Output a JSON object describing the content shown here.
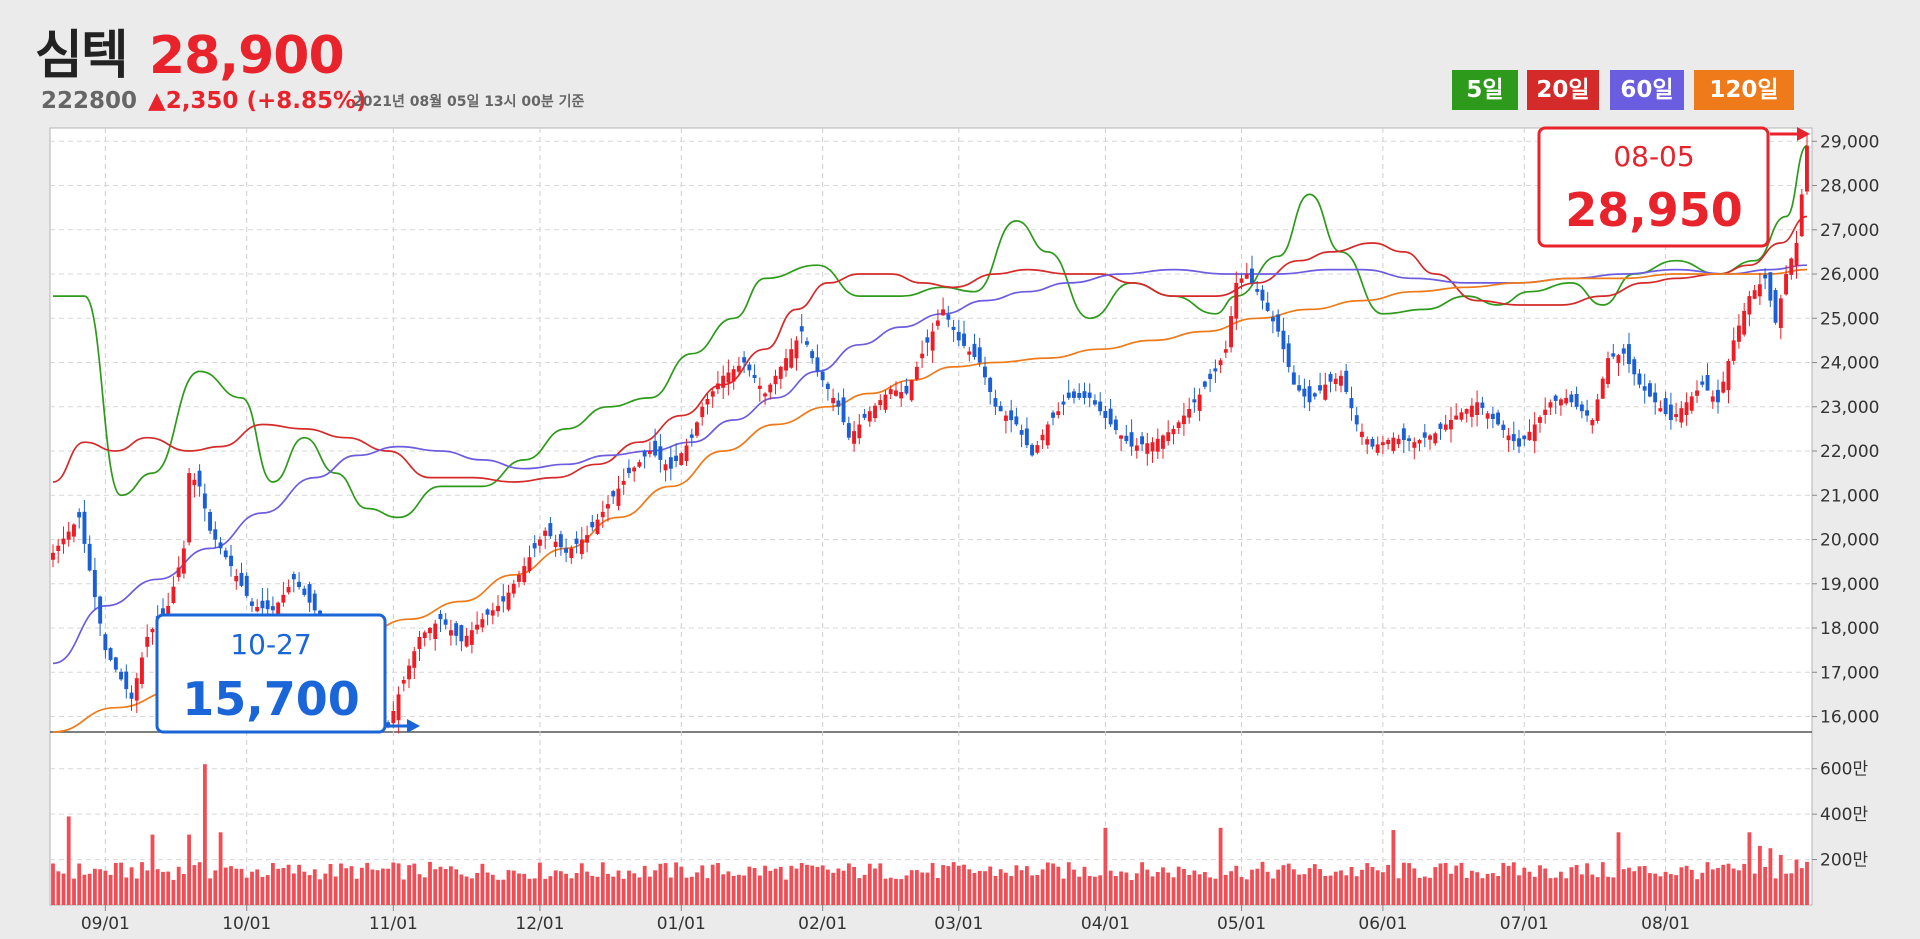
{
  "header": {
    "name": "심텍",
    "price": "28,900",
    "code": "222800",
    "change": "▲2,350 (+8.85%)",
    "timestamp": "2021년 08월 05일 13시 00분 기준"
  },
  "legend": [
    {
      "label": "5일",
      "color": "#2e9a1b"
    },
    {
      "label": "20일",
      "color": "#d42a2a"
    },
    {
      "label": "60일",
      "color": "#6b5de0"
    },
    {
      "label": "120일",
      "color": "#ee7a1a"
    }
  ],
  "callouts": {
    "high": {
      "date": "08-05",
      "value": "28,950"
    },
    "low": {
      "date": "10-27",
      "value": "15,700"
    }
  },
  "chart_data": {
    "type": "candlestick",
    "x_label_dates": [
      "09/01",
      "10/01",
      "11/01",
      "12/01",
      "01/01",
      "02/01",
      "03/01",
      "04/01",
      "05/01",
      "06/01",
      "07/01",
      "08/01"
    ],
    "price_axis": {
      "ylim": [
        15650,
        29300
      ],
      "ticks": [
        "16,000",
        "17,000",
        "18,000",
        "19,000",
        "20,000",
        "21,000",
        "22,000",
        "23,000",
        "24,000",
        "25,000",
        "26,000",
        "27,000",
        "28,000",
        "29,000"
      ]
    },
    "volume_axis": {
      "unit": "만",
      "ticks": [
        "200만",
        "400만",
        "600만"
      ],
      "max": 700
    },
    "close_anchors": [
      [
        0,
        19700
      ],
      [
        5,
        20500
      ],
      [
        10,
        17500
      ],
      [
        15,
        16400
      ],
      [
        18,
        17800
      ],
      [
        22,
        18500
      ],
      [
        25,
        19800
      ],
      [
        26,
        21500
      ],
      [
        28,
        21200
      ],
      [
        30,
        20200
      ],
      [
        34,
        19400
      ],
      [
        38,
        18500
      ],
      [
        42,
        18400
      ],
      [
        46,
        19100
      ],
      [
        50,
        18400
      ],
      [
        54,
        17500
      ],
      [
        58,
        17000
      ],
      [
        62,
        16200
      ],
      [
        64,
        15750
      ],
      [
        66,
        16500
      ],
      [
        70,
        17800
      ],
      [
        74,
        18200
      ],
      [
        78,
        17700
      ],
      [
        82,
        18200
      ],
      [
        86,
        18600
      ],
      [
        90,
        19400
      ],
      [
        94,
        20200
      ],
      [
        98,
        19700
      ],
      [
        102,
        20100
      ],
      [
        106,
        20800
      ],
      [
        110,
        21500
      ],
      [
        114,
        22000
      ],
      [
        118,
        21600
      ],
      [
        122,
        22300
      ],
      [
        124,
        23000
      ],
      [
        128,
        23700
      ],
      [
        132,
        24000
      ],
      [
        136,
        23300
      ],
      [
        140,
        24100
      ],
      [
        143,
        24700
      ],
      [
        146,
        23800
      ],
      [
        150,
        23000
      ],
      [
        152,
        22300
      ],
      [
        156,
        22900
      ],
      [
        160,
        23400
      ],
      [
        163,
        23300
      ],
      [
        166,
        24200
      ],
      [
        170,
        25200
      ],
      [
        173,
        24500
      ],
      [
        177,
        24000
      ],
      [
        180,
        23000
      ],
      [
        184,
        22600
      ],
      [
        187,
        21900
      ],
      [
        190,
        22600
      ],
      [
        194,
        23200
      ],
      [
        198,
        23200
      ],
      [
        202,
        22600
      ],
      [
        206,
        22100
      ],
      [
        210,
        22200
      ],
      [
        214,
        22500
      ],
      [
        218,
        23100
      ],
      [
        222,
        23800
      ],
      [
        224,
        24300
      ],
      [
        226,
        25800
      ],
      [
        228,
        26000
      ],
      [
        231,
        25400
      ],
      [
        234,
        24700
      ],
      [
        237,
        23500
      ],
      [
        240,
        23100
      ],
      [
        243,
        23500
      ],
      [
        246,
        23700
      ],
      [
        249,
        22600
      ],
      [
        252,
        22100
      ],
      [
        256,
        22300
      ],
      [
        260,
        22200
      ],
      [
        264,
        22400
      ],
      [
        268,
        22800
      ],
      [
        272,
        23100
      ],
      [
        276,
        22600
      ],
      [
        280,
        22100
      ],
      [
        283,
        22600
      ],
      [
        286,
        23100
      ],
      [
        289,
        23200
      ],
      [
        292,
        22900
      ],
      [
        294,
        22700
      ],
      [
        297,
        24100
      ],
      [
        300,
        24200
      ],
      [
        303,
        23500
      ],
      [
        306,
        23100
      ],
      [
        309,
        22700
      ],
      [
        312,
        23100
      ],
      [
        315,
        23500
      ],
      [
        318,
        23100
      ],
      [
        321,
        24500
      ],
      [
        324,
        25500
      ],
      [
        327,
        25900
      ],
      [
        329,
        24900
      ],
      [
        331,
        26000
      ],
      [
        333,
        26700
      ],
      [
        335,
        28900
      ]
    ],
    "ma": [
      {
        "name": "5일",
        "color": "#2e9a1b",
        "points": [
          [
            0,
            25500
          ],
          [
            6,
            25500
          ],
          [
            13,
            21000
          ],
          [
            19,
            21500
          ],
          [
            28,
            23800
          ],
          [
            36,
            23200
          ],
          [
            42,
            21300
          ],
          [
            48,
            22300
          ],
          [
            54,
            21500
          ],
          [
            60,
            20700
          ],
          [
            66,
            20500
          ],
          [
            74,
            21200
          ],
          [
            82,
            21200
          ],
          [
            90,
            21800
          ],
          [
            98,
            22500
          ],
          [
            106,
            23000
          ],
          [
            114,
            23200
          ],
          [
            122,
            24200
          ],
          [
            130,
            25000
          ],
          [
            136,
            25900
          ],
          [
            146,
            26200
          ],
          [
            154,
            25500
          ],
          [
            162,
            25500
          ],
          [
            170,
            25700
          ],
          [
            176,
            25600
          ],
          [
            184,
            27200
          ],
          [
            190,
            26500
          ],
          [
            198,
            25000
          ],
          [
            206,
            25800
          ],
          [
            214,
            25500
          ],
          [
            222,
            25100
          ],
          [
            226,
            25500
          ],
          [
            234,
            26400
          ],
          [
            240,
            27800
          ],
          [
            246,
            26500
          ],
          [
            254,
            25100
          ],
          [
            262,
            25200
          ],
          [
            270,
            25500
          ],
          [
            276,
            25300
          ],
          [
            282,
            25600
          ],
          [
            290,
            25800
          ],
          [
            296,
            25300
          ],
          [
            302,
            26000
          ],
          [
            310,
            26300
          ],
          [
            318,
            26000
          ],
          [
            325,
            26300
          ],
          [
            331,
            27300
          ],
          [
            335,
            28900
          ]
        ]
      },
      {
        "name": "20일",
        "color": "#d42a2a",
        "points": [
          [
            0,
            21300
          ],
          [
            6,
            22200
          ],
          [
            12,
            22000
          ],
          [
            18,
            22300
          ],
          [
            26,
            22000
          ],
          [
            32,
            22100
          ],
          [
            40,
            22600
          ],
          [
            48,
            22500
          ],
          [
            56,
            22300
          ],
          [
            64,
            22000
          ],
          [
            72,
            21400
          ],
          [
            80,
            21400
          ],
          [
            88,
            21300
          ],
          [
            96,
            21400
          ],
          [
            104,
            21700
          ],
          [
            112,
            22200
          ],
          [
            120,
            22800
          ],
          [
            128,
            23500
          ],
          [
            136,
            24300
          ],
          [
            142,
            25200
          ],
          [
            148,
            25800
          ],
          [
            154,
            26000
          ],
          [
            160,
            26000
          ],
          [
            166,
            25800
          ],
          [
            172,
            25700
          ],
          [
            180,
            26000
          ],
          [
            186,
            26100
          ],
          [
            194,
            26000
          ],
          [
            200,
            26000
          ],
          [
            206,
            25800
          ],
          [
            214,
            25500
          ],
          [
            222,
            25500
          ],
          [
            230,
            25800
          ],
          [
            238,
            26300
          ],
          [
            244,
            26500
          ],
          [
            252,
            26700
          ],
          [
            258,
            26500
          ],
          [
            264,
            26000
          ],
          [
            272,
            25400
          ],
          [
            280,
            25300
          ],
          [
            288,
            25300
          ],
          [
            296,
            25500
          ],
          [
            304,
            25800
          ],
          [
            310,
            25900
          ],
          [
            318,
            26000
          ],
          [
            324,
            26200
          ],
          [
            330,
            26700
          ],
          [
            335,
            27300
          ]
        ]
      },
      {
        "name": "60일",
        "color": "#6b5de0",
        "points": [
          [
            0,
            17200
          ],
          [
            10,
            18500
          ],
          [
            20,
            19100
          ],
          [
            30,
            19800
          ],
          [
            40,
            20600
          ],
          [
            50,
            21400
          ],
          [
            58,
            21900
          ],
          [
            66,
            22100
          ],
          [
            74,
            22000
          ],
          [
            82,
            21800
          ],
          [
            90,
            21600
          ],
          [
            98,
            21700
          ],
          [
            106,
            21900
          ],
          [
            114,
            22000
          ],
          [
            122,
            22200
          ],
          [
            130,
            22700
          ],
          [
            138,
            23200
          ],
          [
            146,
            23800
          ],
          [
            154,
            24400
          ],
          [
            162,
            24800
          ],
          [
            170,
            25100
          ],
          [
            178,
            25400
          ],
          [
            186,
            25600
          ],
          [
            194,
            25800
          ],
          [
            204,
            26000
          ],
          [
            214,
            26100
          ],
          [
            224,
            26000
          ],
          [
            234,
            26000
          ],
          [
            244,
            26100
          ],
          [
            250,
            26100
          ],
          [
            260,
            25900
          ],
          [
            270,
            25800
          ],
          [
            280,
            25800
          ],
          [
            290,
            25900
          ],
          [
            300,
            26000
          ],
          [
            310,
            26100
          ],
          [
            320,
            26000
          ],
          [
            328,
            26100
          ],
          [
            335,
            26200
          ]
        ]
      },
      {
        "name": "120일",
        "color": "#ee7a1a",
        "points": [
          [
            0,
            15650
          ],
          [
            12,
            16200
          ],
          [
            24,
            16600
          ],
          [
            36,
            17100
          ],
          [
            48,
            17500
          ],
          [
            58,
            17800
          ],
          [
            68,
            18200
          ],
          [
            78,
            18600
          ],
          [
            88,
            19200
          ],
          [
            98,
            19800
          ],
          [
            108,
            20500
          ],
          [
            118,
            21200
          ],
          [
            128,
            22000
          ],
          [
            138,
            22600
          ],
          [
            148,
            23000
          ],
          [
            156,
            23300
          ],
          [
            164,
            23600
          ],
          [
            172,
            23900
          ],
          [
            180,
            24000
          ],
          [
            190,
            24100
          ],
          [
            200,
            24300
          ],
          [
            210,
            24500
          ],
          [
            220,
            24700
          ],
          [
            230,
            25000
          ],
          [
            240,
            25200
          ],
          [
            250,
            25400
          ],
          [
            260,
            25600
          ],
          [
            270,
            25700
          ],
          [
            280,
            25800
          ],
          [
            290,
            25900
          ],
          [
            300,
            25900
          ],
          [
            310,
            26000
          ],
          [
            320,
            26000
          ],
          [
            328,
            26000
          ],
          [
            335,
            26100
          ]
        ]
      }
    ],
    "volume_spikes": [
      [
        3,
        390
      ],
      [
        19,
        310
      ],
      [
        26,
        310
      ],
      [
        29,
        620
      ],
      [
        32,
        320
      ],
      [
        201,
        340
      ],
      [
        223,
        340
      ],
      [
        256,
        330
      ],
      [
        299,
        320
      ],
      [
        324,
        320
      ],
      [
        326,
        260
      ],
      [
        328,
        250
      ],
      [
        330,
        220
      ],
      [
        333,
        200
      ],
      [
        335,
        190
      ]
    ]
  }
}
